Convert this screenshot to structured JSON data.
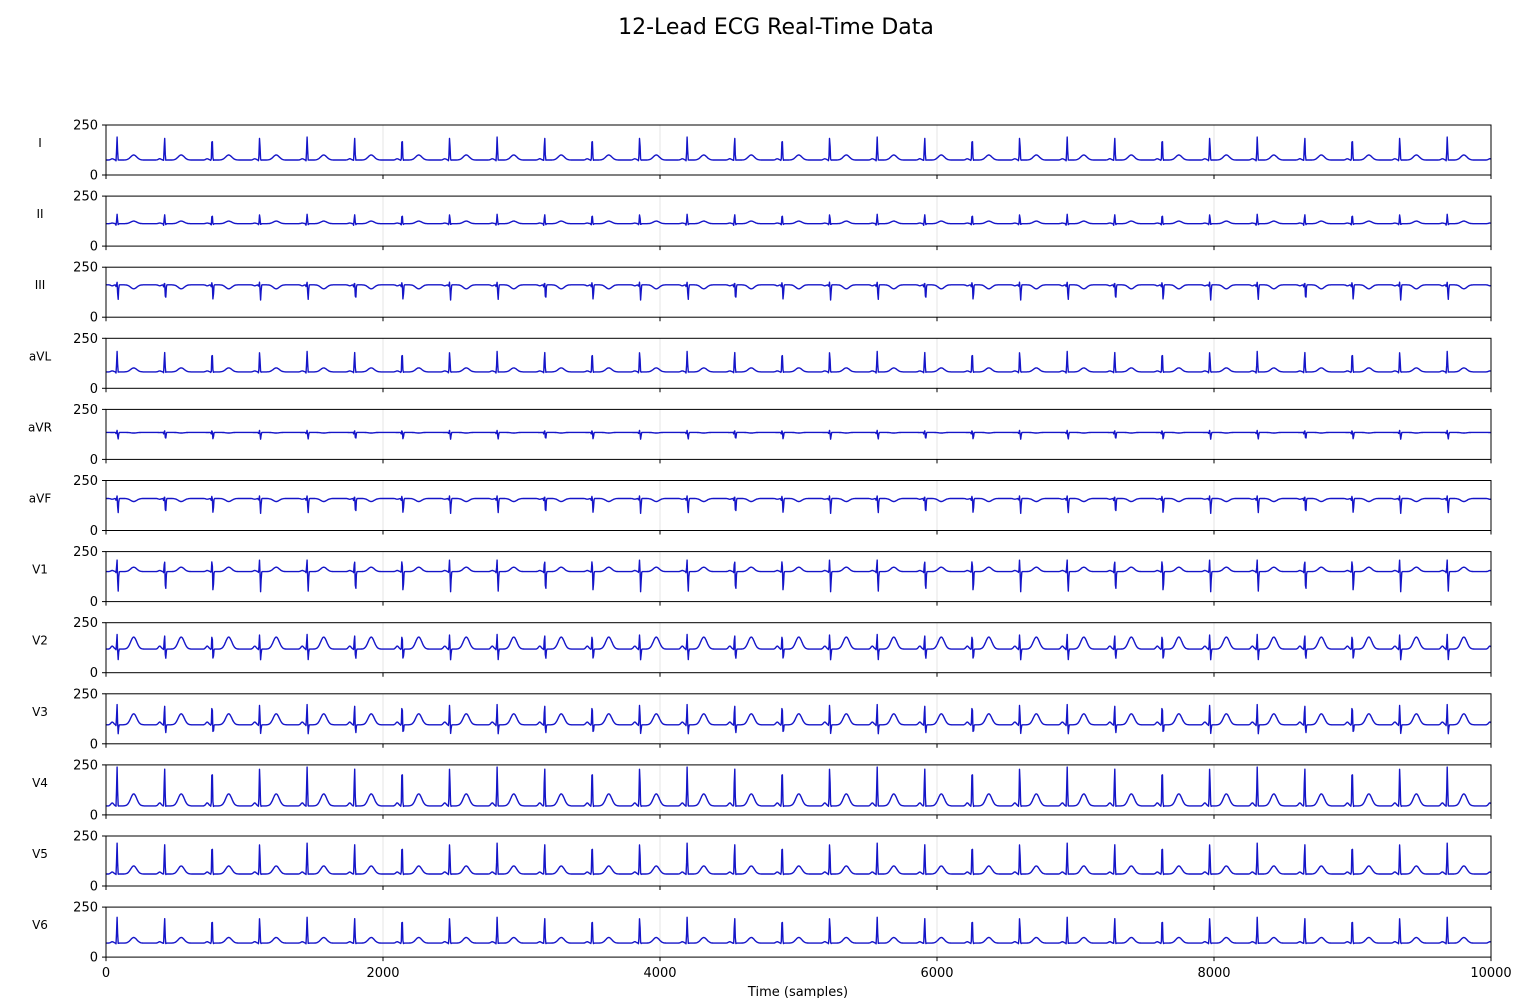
{
  "chart_data": {
    "type": "line",
    "title": "12-Lead ECG Real-Time Data",
    "xlabel": "Time (samples)",
    "ylabel": "",
    "xlim": [
      0,
      10000
    ],
    "ylim": [
      0,
      250
    ],
    "x_ticks": [
      "0",
      "2000",
      "4000",
      "6000",
      "8000",
      "10000"
    ],
    "y_ticks": [
      "0",
      "250"
    ],
    "grid": "vertical gridlines at x ticks (faint)",
    "line_color": "#1515c8",
    "beat_interval_samples": 343,
    "first_beat_sample": 80,
    "leads": [
      {
        "name": "I",
        "baseline": 75,
        "r": 190,
        "q": 65,
        "s": 72,
        "t": 100
      },
      {
        "name": "II",
        "baseline": 112,
        "r": 160,
        "q": 100,
        "s": 106,
        "t": 125
      },
      {
        "name": "III",
        "baseline": 162,
        "r": 180,
        "q": 150,
        "s": 85,
        "t": 142
      },
      {
        "name": "aVL",
        "baseline": 82,
        "r": 185,
        "q": 70,
        "s": 78,
        "t": 102
      },
      {
        "name": "aVR",
        "baseline": 135,
        "r": 148,
        "q": 126,
        "s": 100,
        "t": 132
      },
      {
        "name": "aVF",
        "baseline": 160,
        "r": 178,
        "q": 148,
        "s": 85,
        "t": 145
      },
      {
        "name": "V1",
        "baseline": 150,
        "r": 215,
        "q": 140,
        "s": 45,
        "t": 172
      },
      {
        "name": "V2",
        "baseline": 118,
        "r": 195,
        "q": 110,
        "s": 60,
        "t": 178
      },
      {
        "name": "V3",
        "baseline": 95,
        "r": 200,
        "q": 85,
        "s": 45,
        "t": 150
      },
      {
        "name": "V4",
        "baseline": 45,
        "r": 240,
        "q": 35,
        "s": 40,
        "t": 105
      },
      {
        "name": "V5",
        "baseline": 60,
        "r": 215,
        "q": 50,
        "s": 55,
        "t": 100
      },
      {
        "name": "V6",
        "baseline": 70,
        "r": 200,
        "q": 60,
        "s": 65,
        "t": 98
      }
    ]
  }
}
